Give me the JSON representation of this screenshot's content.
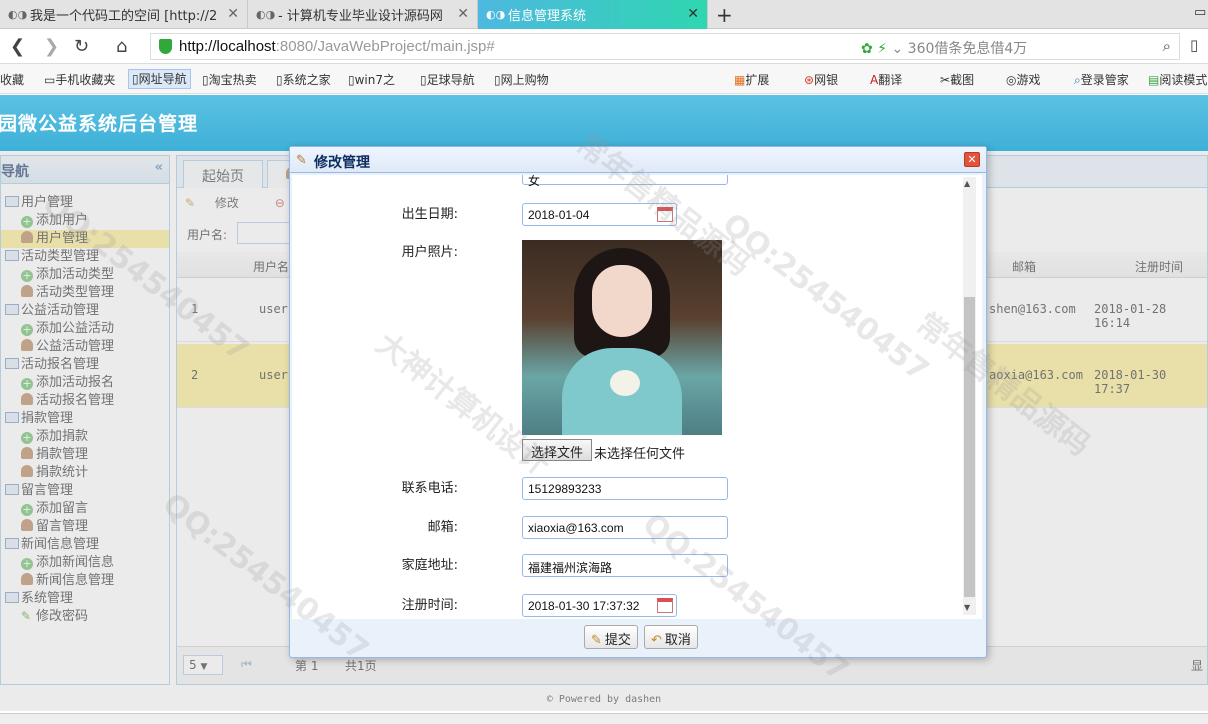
{
  "browser": {
    "tabs": [
      {
        "title": "我是一个代码工的空间 [http://2"
      },
      {
        "title": "- 计算机专业毕业设计源码网"
      },
      {
        "title": "信息管理系统"
      }
    ],
    "new_tab": "+",
    "url_host": "http://localhost",
    "url_rest": ":8080/JavaWebProject/main.jsp#",
    "search_hint": "360借条免息借4万",
    "bookmarks": [
      "收藏",
      "手机收藏夹",
      "网址导航",
      "淘宝热卖",
      "系统之家",
      "win7之",
      "足球导航",
      "网上购物",
      "扩展",
      "网银",
      "翻译",
      "截图",
      "游戏",
      "登录管家",
      "阅读模式"
    ]
  },
  "app": {
    "title": "园微公益系统后台管理",
    "nav_title": "导航",
    "nav_collapse": "«",
    "tree": [
      {
        "label": "用户管理",
        "type": "group"
      },
      {
        "label": "添加用户",
        "type": "add"
      },
      {
        "label": "用户管理",
        "type": "user",
        "selected": true
      },
      {
        "label": "活动类型管理",
        "type": "group"
      },
      {
        "label": "添加活动类型",
        "type": "add"
      },
      {
        "label": "活动类型管理",
        "type": "user"
      },
      {
        "label": "公益活动管理",
        "type": "group"
      },
      {
        "label": "添加公益活动",
        "type": "add"
      },
      {
        "label": "公益活动管理",
        "type": "user"
      },
      {
        "label": "活动报名管理",
        "type": "group"
      },
      {
        "label": "添加活动报名",
        "type": "add"
      },
      {
        "label": "活动报名管理",
        "type": "user"
      },
      {
        "label": "捐款管理",
        "type": "group"
      },
      {
        "label": "添加捐款",
        "type": "add"
      },
      {
        "label": "捐款管理",
        "type": "user"
      },
      {
        "label": "捐款统计",
        "type": "user"
      },
      {
        "label": "留言管理",
        "type": "group"
      },
      {
        "label": "添加留言",
        "type": "add"
      },
      {
        "label": "留言管理",
        "type": "user"
      },
      {
        "label": "新闻信息管理",
        "type": "group"
      },
      {
        "label": "添加新闻信息",
        "type": "add"
      },
      {
        "label": "新闻信息管理",
        "type": "user"
      },
      {
        "label": "系统管理",
        "type": "group"
      },
      {
        "label": "修改密码",
        "type": "pen"
      }
    ],
    "main_tab": "起始页",
    "toolbar": {
      "edit": "修改",
      "delete": "删除"
    },
    "search_label": "用户名:",
    "grid_columns": {
      "username": "用户名",
      "email": "邮箱",
      "regtime": "注册时间"
    },
    "rows": [
      {
        "num": "1",
        "user": "user",
        "email": "shen@163.com",
        "time": "2018-01-28 16:14"
      },
      {
        "num": "2",
        "user": "user",
        "email": "aoxia@163.com",
        "time": "2018-01-30 17:37"
      }
    ],
    "pager": {
      "size": "5",
      "page_prefix": "第",
      "page": "1",
      "total": "共1页",
      "right": "显"
    },
    "footer": "© Powered by dashen"
  },
  "dialog": {
    "title": "修改管理",
    "partial_value": "女",
    "labels": {
      "birth": "出生日期:",
      "photo": "用户照片:",
      "phone": "联系电话:",
      "email": "邮箱:",
      "address": "家庭地址:",
      "regtime": "注册时间:"
    },
    "values": {
      "birth": "2018-01-04",
      "phone": "15129893233",
      "email": "xiaoxia@163.com",
      "address": "福建福州滨海路",
      "regtime": "2018-01-30 17:37:32"
    },
    "file_button": "选择文件",
    "file_status": "未选择任何文件",
    "submit": "提交",
    "cancel": "取消"
  },
  "watermark": [
    "QQ:254540457",
    "大神计算机设计",
    "常年售精品源码"
  ]
}
